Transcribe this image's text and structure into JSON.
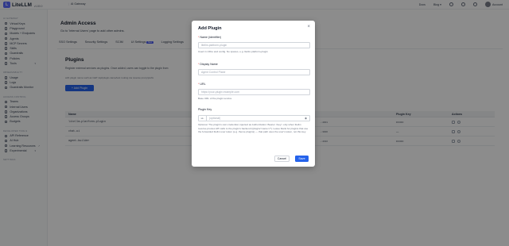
{
  "header": {
    "logo_mark": "L",
    "app_name": "LiteLLM",
    "version": "v1.80.0",
    "gateway": "AI Gateway",
    "docs": "Docs",
    "blog": "Blog",
    "account": "Account"
  },
  "sidebar": {
    "sections": [
      {
        "title": "AI GATEWAY",
        "items": [
          {
            "label": "Virtual Keys",
            "icon": "key-icon"
          },
          {
            "label": "Playground",
            "icon": "playground-icon"
          },
          {
            "label": "Models + Endpoints",
            "icon": "models-icon"
          },
          {
            "label": "Agents",
            "icon": "agents-icon"
          },
          {
            "label": "MCP Servers",
            "icon": "mcp-icon"
          },
          {
            "label": "Skills",
            "icon": "skills-icon"
          },
          {
            "label": "Guardrails",
            "icon": "shield-icon"
          },
          {
            "label": "Policies",
            "icon": "policy-icon"
          },
          {
            "label": "Tools",
            "icon": "tools-icon",
            "caret": "▾"
          }
        ]
      },
      {
        "title": "OBSERVABILITY",
        "items": [
          {
            "label": "Usage",
            "icon": "chart-icon"
          },
          {
            "label": "Logs",
            "icon": "logs-icon"
          },
          {
            "label": "Guardrails Monitor",
            "icon": "monitor-icon"
          }
        ]
      },
      {
        "title": "ACCESS CONTROL",
        "items": [
          {
            "label": "Teams",
            "icon": "team-icon"
          },
          {
            "label": "Internal Users",
            "icon": "user-icon"
          },
          {
            "label": "Organizations",
            "icon": "org-icon"
          },
          {
            "label": "Access Groups",
            "icon": "group-icon"
          },
          {
            "label": "Budgets",
            "icon": "budget-icon"
          }
        ]
      },
      {
        "title": "DEVELOPER TOOLS",
        "items": [
          {
            "label": "API Reference",
            "icon": "api-icon"
          },
          {
            "label": "AI Hub",
            "icon": "hub-icon"
          },
          {
            "label": "Learning Resources",
            "icon": "book-icon",
            "caret": "↗"
          },
          {
            "label": "Experimental",
            "icon": "flask-icon",
            "caret": "▾"
          }
        ]
      },
      {
        "title": "SETTINGS",
        "items": []
      }
    ]
  },
  "main": {
    "title": "Admin Access",
    "subtitle": "Go to 'Internal Users' page to add other admins.",
    "tabs": [
      {
        "label": "SSO Settings"
      },
      {
        "label": "Security Settings"
      },
      {
        "label": "SCIM"
      },
      {
        "label": "UI Settings",
        "badge": "New"
      },
      {
        "label": "Logging Settings"
      }
    ],
    "plugins_title": "Plugins",
    "plugins_desc": "Register external services as plugins. Once added, users can toggle to the plugin from",
    "plugins_desc2": "with plugin name such as  GET /api/plugin-name/test  routing via reverse proxy/prefix",
    "add_button": "+ Add Plugin",
    "table": {
      "headers": [
        "Name",
        "",
        "Plugin Key",
        "Actions"
      ],
      "rows": [
        {
          "name": "litellm-platform-plugin",
          "url": "...:4001",
          "key": "••••••••"
        },
        {
          "name": "chat-ui",
          "url": "...:3000",
          "key": "—"
        },
        {
          "name": "agent-builder",
          "url": "...:4010",
          "key": "••••••••"
        }
      ]
    }
  },
  "modal": {
    "title": "Add Plugin",
    "close": "×",
    "name_label": "Name (identifier)",
    "name_placeholder": "litellm-platform-plugin",
    "name_help": "Used in URLs and config. No spaces, e.g. litellm-platform-plugin",
    "display_label": "Display Name",
    "display_placeholder": "Agent Control Plane",
    "url_label": "URL",
    "url_placeholder": "https://your-plugin.example.com",
    "url_help": "Base URL of the plugin service",
    "key_label": "Plugin Key",
    "key_prefix": "sk-",
    "key_placeholder": "(optional)",
    "key_help": "Optional. The plugin's own credential, injected as Authorization: Bearer <key> only when litellm reverse-proxies API calls to the plugin's backend (/plugin/<name>/*). Leave blank for plugins that use the forwarded litellm user token (e.g. theme plugins) — that path uses the user's token, not this key.",
    "cancel": "Cancel",
    "save": "Save"
  }
}
